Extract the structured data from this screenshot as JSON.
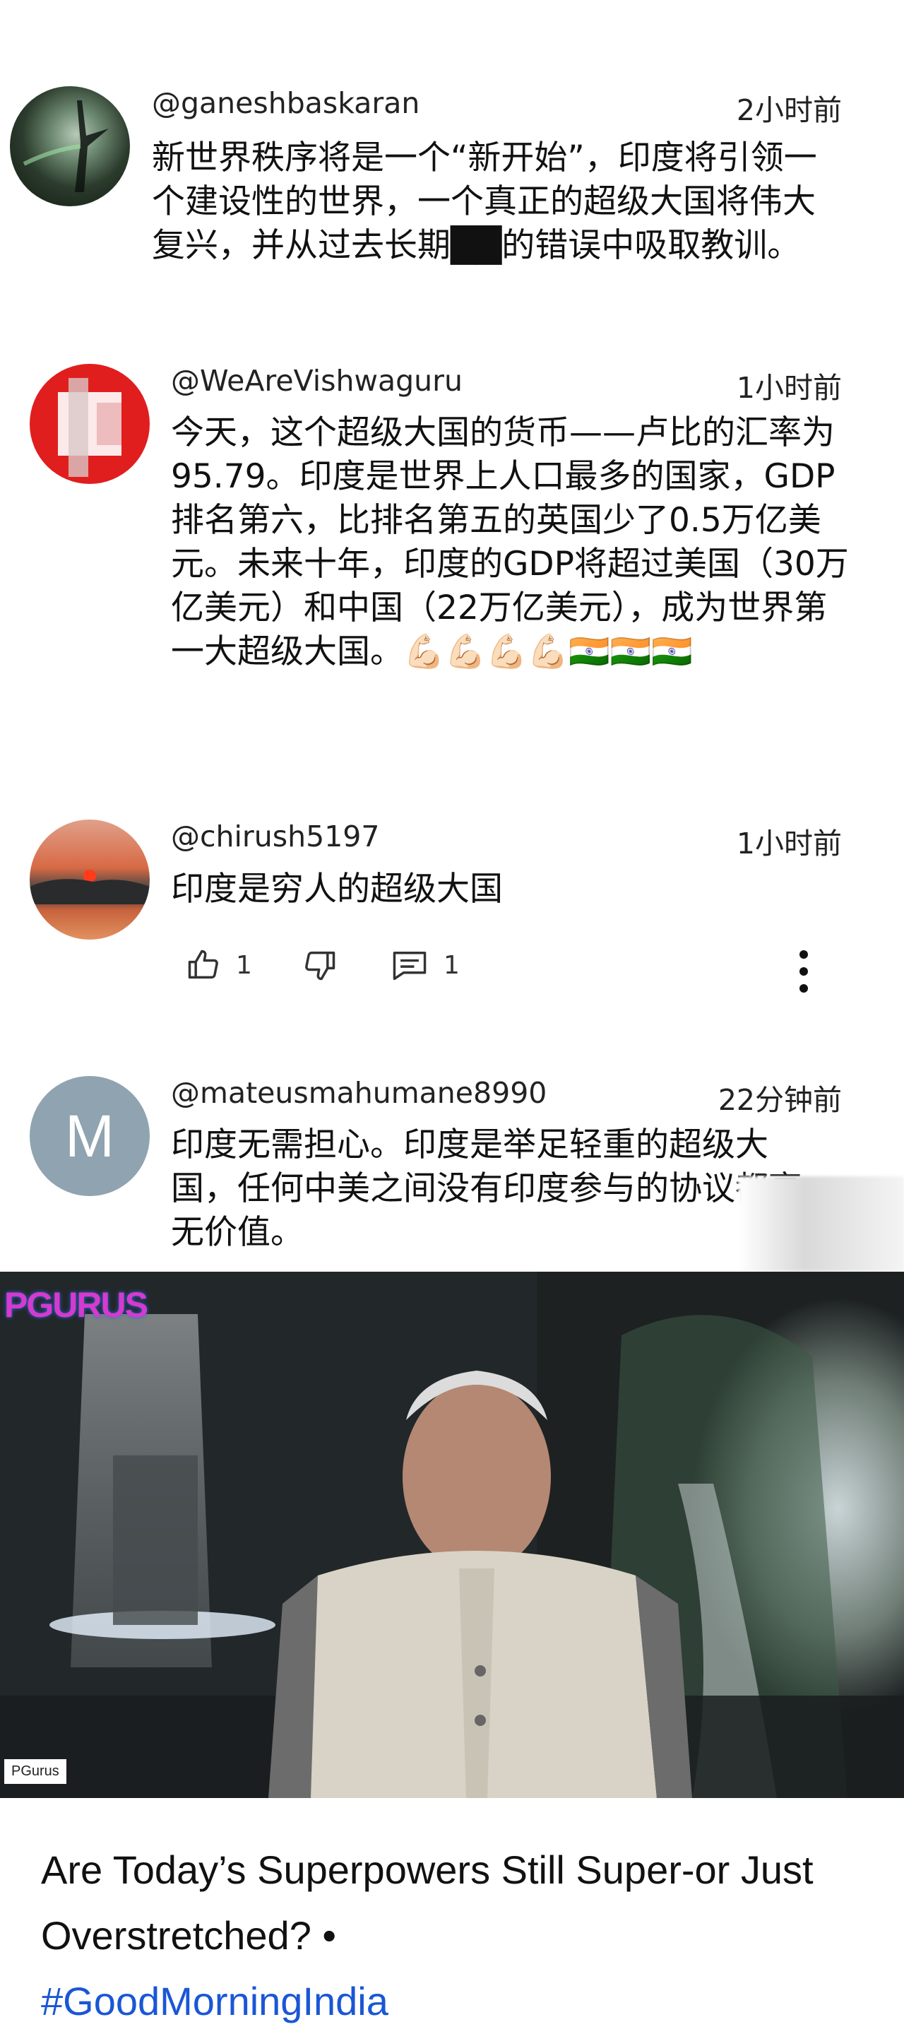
{
  "comments": [
    {
      "handle": "@ganeshbaskaran",
      "time": "2小时前",
      "text": "新世界秩序将是一个“新开始”，印度将引领一个建设性的世界，一个真正的超级大国将伟大复兴，并从过去长期██的错误中吸取教训。"
    },
    {
      "handle": "@WeAreVishwaguru",
      "time": "1小时前",
      "text": "今天，这个超级大国的货币——卢比的汇率为95.79。印度是世界上人口最多的国家，GDP排名第六，比排名第五的英国少了0.5万亿美元。未来十年，印度的GDP将超过美国（30万亿美元）和中国（22万亿美元），成为世界第一大超级大国。💪🏻💪🏻💪🏻💪🏻🇮🇳🇮🇳🇮🇳"
    },
    {
      "handle": "@chirush5197",
      "time": "1小时前",
      "text": "印度是穷人的超级大国",
      "likes": "1",
      "replies": "1"
    },
    {
      "handle": "@mateusmahumane8990",
      "time": "22分钟前",
      "avatar_letter": "M",
      "text": "印度无需担心。印度是举足轻重的超级大国，任何中美之间没有印度参与的协议都毫无价值。"
    }
  ],
  "video": {
    "logo": "PGURUS",
    "channel_badge": "PGurus"
  },
  "card": {
    "title": "Are Today’s Superpowers Still Super-or Just Overstretched? •",
    "hashtag": "#GoodMorningIndia"
  },
  "colors": {
    "hashtag": "#1a56d6",
    "avatar_m": "#8fa3b0"
  }
}
